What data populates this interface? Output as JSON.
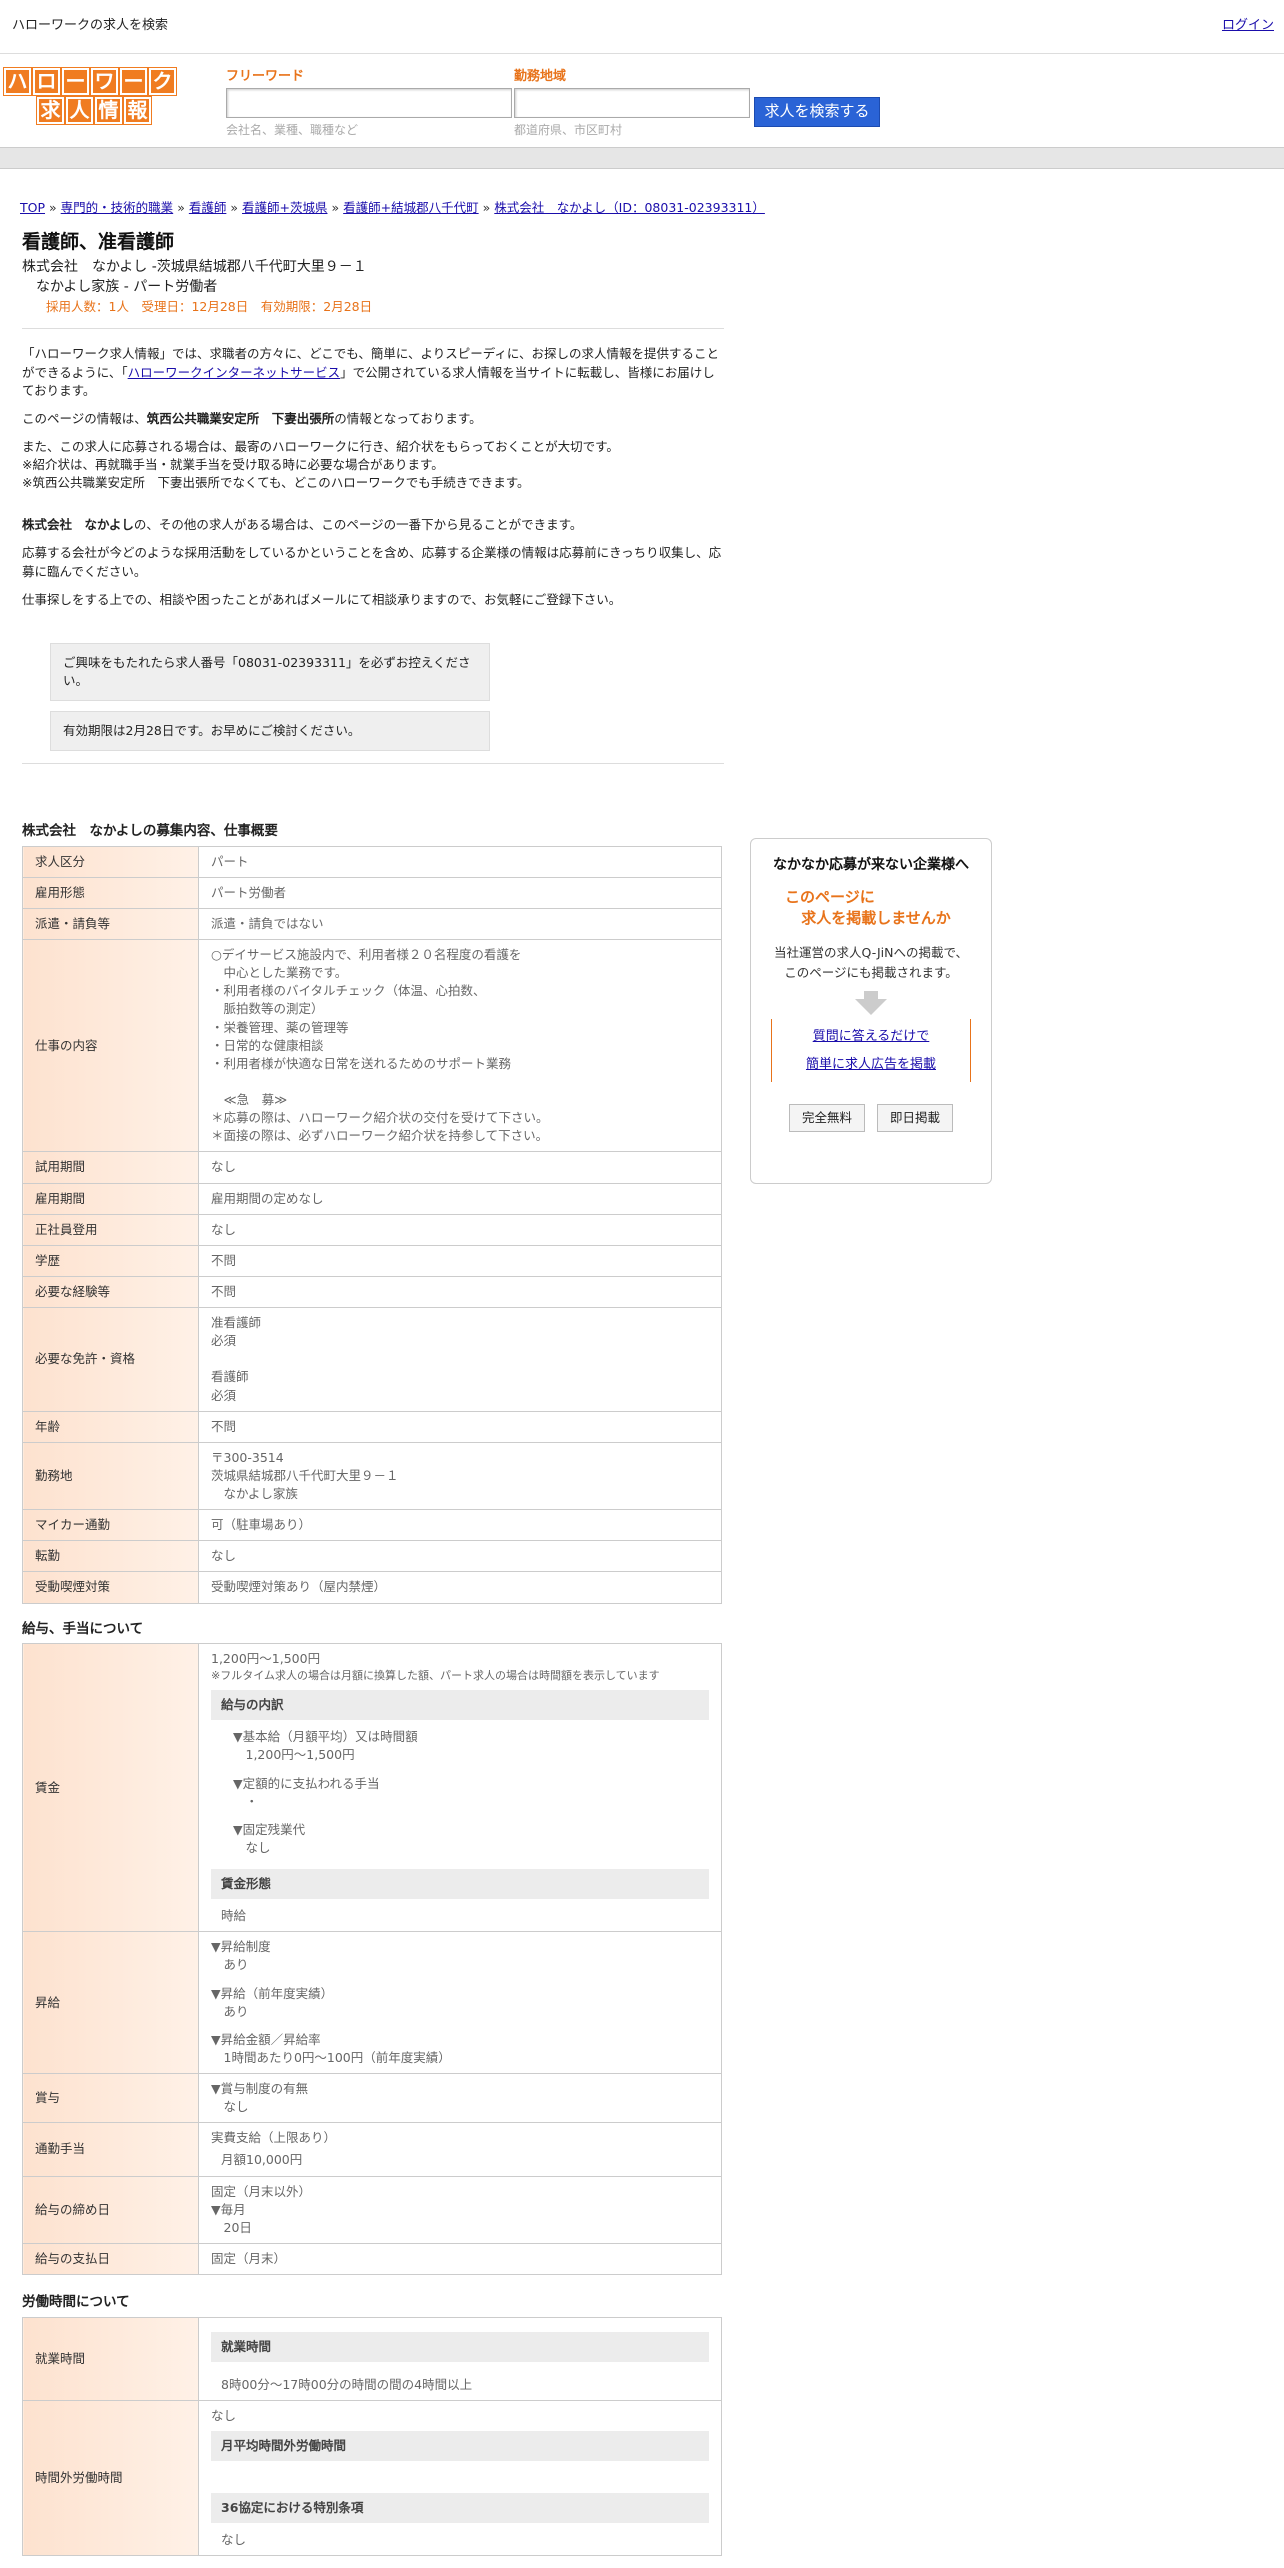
{
  "topbar": {
    "site_title": "ハローワークの求人を検索",
    "login": "ログイン"
  },
  "logo": {
    "row1": [
      "ハ",
      "ロ",
      "ー",
      "ワ",
      "ー",
      "ク"
    ],
    "row2": [
      "求",
      "人",
      "情",
      "報"
    ]
  },
  "search": {
    "keyword_label": "フリーワード",
    "keyword_hint": "会社名、業種、職種など",
    "area_label": "勤務地域",
    "area_hint": "都道府県、市区町村",
    "button": "求人を検索する"
  },
  "breadcrumb": [
    "TOP",
    "専門的・技術的職業",
    "看護師",
    "看護師+茨城県",
    "看護師+結城郡八千代町",
    "株式会社　なかよし（ID：08031-02393311）"
  ],
  "job": {
    "title": "看護師、准看護師",
    "company_line": "株式会社　なかよし -茨城県結城郡八千代町大里９－１",
    "sub_line": "なかよし家族 - パート労働者",
    "meta": "採用人数：1人　受理日：12月28日　有効期限：2月28日"
  },
  "intro": {
    "p1a": "「ハローワーク求人情報」では、求職者の方々に、どこでも、簡単に、よりスピーディに、お探しの求人情報を提供することができるように、「",
    "p1link": "ハローワークインターネットサービス",
    "p1b": "」で公開されている求人情報を当サイトに転載し、皆様にお届けしております。",
    "p2a": "このページの情報は、",
    "p2b": "筑西公共職業安定所　下妻出張所",
    "p2c": "の情報となっております。",
    "p3": "また、この求人に応募される場合は、最寄のハローワークに行き、紹介状をもらっておくことが大切です。\n※紹介状は、再就職手当・就業手当を受け取る時に必要な場合があります。\n※筑西公共職業安定所　下妻出張所でなくても、どこのハローワークでも手続きできます。",
    "p4a": "株式会社　なかよし",
    "p4b": "の、その他の求人がある場合は、このページの一番下から見ることができます。",
    "p5": "応募する会社が今どのような採用活動をしているかということを含め、応募する企業様の情報は応募前にきっちり収集し、応募に臨んでください。",
    "p6": "仕事探しをする上での、相談や困ったことがあればメールにて相談承りますので、お気軽にご登録下さい。",
    "notice1": "ご興味をもたれたら求人番号「08031-02393311」を必ずお控えください。",
    "notice2": "有効期限は2月28日です。お早めにご検討ください。"
  },
  "section1": {
    "title": "株式会社　なかよしの募集内容、仕事概要",
    "rows": [
      {
        "k": "求人区分",
        "v": "パート"
      },
      {
        "k": "雇用形態",
        "v": "パート労働者"
      },
      {
        "k": "派遣・請負等",
        "v": "派遣・請負ではない"
      },
      {
        "k": "仕事の内容",
        "v": "○デイサービス施設内で、利用者様２０名程度の看護を\n　中心とした業務です。\n・利用者様のバイタルチェック（体温、心拍数、\n　脈拍数等の測定）\n・栄養管理、薬の管理等\n・日常的な健康相談\n・利用者様が快適な日常を送れるためのサポート業務\n\n　≪急　募≫\n＊応募の際は、ハローワーク紹介状の交付を受けて下さい。\n＊面接の際は、必ずハローワーク紹介状を持参して下さい。"
      },
      {
        "k": "試用期間",
        "v": "なし"
      },
      {
        "k": "雇用期間",
        "v": "雇用期間の定めなし"
      },
      {
        "k": "正社員登用",
        "v": "なし"
      },
      {
        "k": "学歴",
        "v": "不問"
      },
      {
        "k": "必要な経験等",
        "v": "不問"
      },
      {
        "k": "必要な免許・資格",
        "v": "准看護師\n必須\n\n看護師\n必須\n"
      },
      {
        "k": "年齢",
        "v": "不問"
      },
      {
        "k": "勤務地",
        "v": "〒300-3514\n茨城県結城郡八千代町大里９－１\n　なかよし家族"
      },
      {
        "k": "マイカー通勤",
        "v": "可（駐車場あり）"
      },
      {
        "k": "転勤",
        "v": "なし"
      },
      {
        "k": "受動喫煙対策",
        "v": "受動喫煙対策あり（屋内禁煙）"
      }
    ]
  },
  "section2": {
    "title": "給与、手当について",
    "wage": {
      "k": "賃金",
      "range": "1,200円〜1,500円",
      "note": "※フルタイム求人の場合は月額に換算した額、パート求人の場合は時間額を表示しています",
      "breakdown_head": "給与の内訳",
      "b1": "▼基本給（月額平均）又は時間額\n　1,200円〜1,500円",
      "b2": "▼定額的に支払われる手当\n　・",
      "b3": "▼固定残業代\n　なし",
      "form_head": "賃金形態",
      "form": "時給"
    },
    "raise": {
      "k": "昇給",
      "v1": "▼昇給制度\n　あり",
      "v2": "▼昇給（前年度実績）\n　あり",
      "v3": "▼昇給金額／昇給率\n　1時間あたり0円〜100円（前年度実績）"
    },
    "bonus": {
      "k": "賞与",
      "v": "▼賞与制度の有無\n　なし"
    },
    "commute": {
      "k": "通勤手当",
      "v1": "実費支給（上限あり）",
      "v2": "月額10,000円"
    },
    "closing": {
      "k": "給与の締め日",
      "v": "固定（月末以外）\n▼毎月\n　20日"
    },
    "payday": {
      "k": "給与の支払日",
      "v": "固定（月末）"
    }
  },
  "section3": {
    "title": "労働時間について",
    "work_hours": {
      "k": "就業時間",
      "head": "就業時間",
      "v": "8時00分〜17時00分の時間の間の4時間以上"
    },
    "overtime": {
      "k": "時間外労働時間",
      "v": "なし",
      "head1": "月平均時間外労働時間",
      "head2": "36協定における特別条項",
      "v2": "なし"
    }
  },
  "side": {
    "t1": "なかなか応募が来ない企業様へ",
    "t2a": "このページに",
    "t2b": "求人を掲載しませんか",
    "t3a": "当社運営の求人Q-JiNへの掲載で、",
    "t3b": "このページにも掲載されます。",
    "link1": "質問に答えるだけで",
    "link2": "簡単に求人広告を掲載",
    "btn1": "完全無料",
    "btn2": "即日掲載"
  }
}
